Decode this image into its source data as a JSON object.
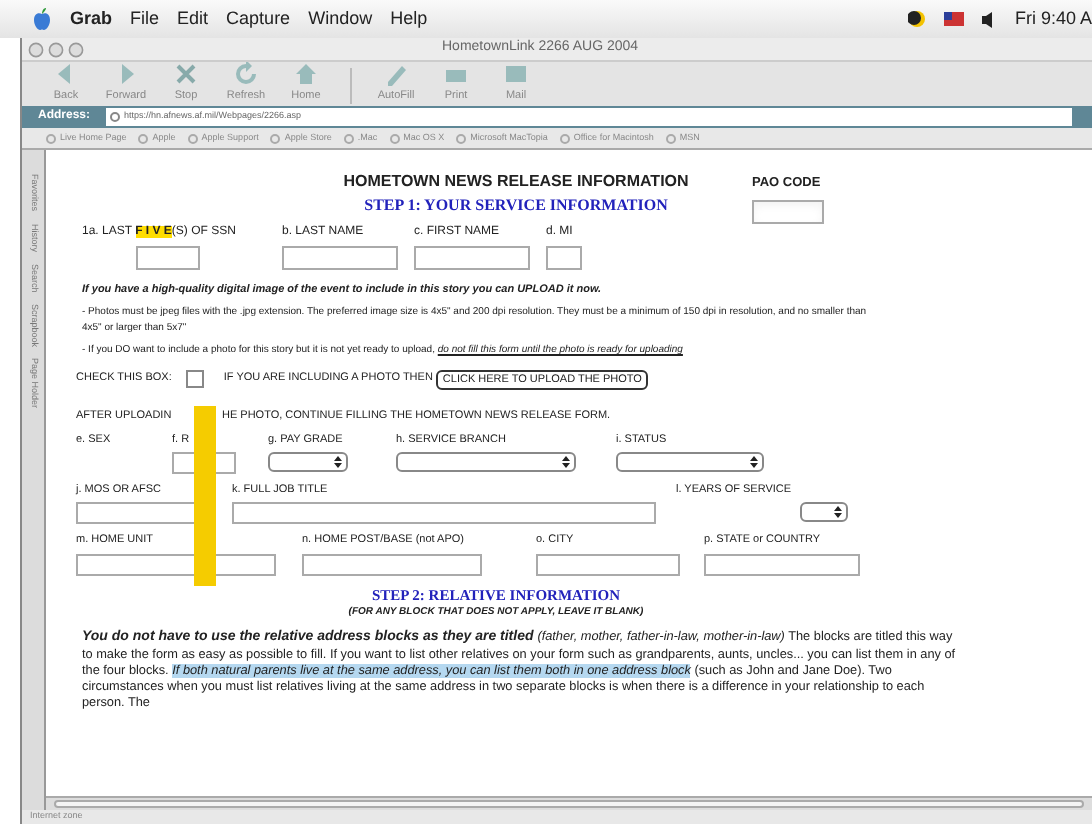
{
  "menubar": {
    "app": "Grab",
    "menus": [
      "File",
      "Edit",
      "Capture",
      "Window",
      "Help"
    ],
    "clock": "Fri 9:40 A"
  },
  "window": {
    "title": "HometownLink 2266 AUG 2004"
  },
  "toolbar": [
    {
      "kind": "button",
      "label": "Back"
    },
    {
      "kind": "button",
      "label": "Forward"
    },
    {
      "kind": "button",
      "label": "Stop"
    },
    {
      "kind": "button",
      "label": "Refresh"
    },
    {
      "kind": "button",
      "label": "Home"
    },
    {
      "kind": "separator"
    },
    {
      "kind": "button",
      "label": "AutoFill"
    },
    {
      "kind": "button",
      "label": "Print"
    },
    {
      "kind": "button",
      "label": "Mail"
    }
  ],
  "address": {
    "label": "Address:",
    "url": "https://hn.afnews.af.mil/Webpages/2266.asp"
  },
  "bookmarks": [
    "Live Home Page",
    "Apple",
    "Apple Support",
    "Apple Store",
    ".Mac",
    "Mac OS X",
    "Microsoft MacTopia",
    "Office for Macintosh",
    "MSN"
  ],
  "sidebar_tabs": [
    "Favorites",
    "History",
    "Search",
    "Scrapbook",
    "Page Holder"
  ],
  "form": {
    "heading": "HOMETOWN NEWS RELEASE INFORMATION",
    "step1": "STEP 1: YOUR SERVICE INFORMATION",
    "pao_label": "PAO CODE",
    "ssn_label": {
      "before": "1a. LAST",
      "highlight": "F I V E",
      "after": "(S) OF SSN"
    },
    "name_fields": [
      {
        "label": "b. LAST NAME"
      },
      {
        "label": "c. FIRST NAME"
      },
      {
        "label": "d. MI"
      }
    ],
    "upload_intro": "If you have a high-quality digital image of the event to include in this story you can UPLOAD it now.",
    "photo_note": "- Photos must be jpeg files with the .jpg extension. The preferred image size is 4x5\" and 200 dpi resolution. They must be a minimum of 150 dpi in resolution, and no smaller than 4x5\" or larger than 5x7\"",
    "ready_note": {
      "text": "- If you DO want to include a photo for this story but it is not yet ready to upload, ",
      "emphasis": "do not fill this form until the photo is ready for uploading"
    },
    "check_label": "CHECK THIS BOX:",
    "check": {
      "checked": false
    },
    "check_after": "IF YOU ARE INCLUDING A PHOTO THEN",
    "upload_button": "CLICK HERE TO UPLOAD THE PHOTO",
    "after_upload": [
      "AFTER UPLOADIN",
      "HE PHOTO, CONTINUE FILLING THE HOMETOWN NEWS RELEASE FORM."
    ],
    "rows": [
      [
        {
          "label": "e. SEX",
          "kind": "none"
        },
        {
          "label": "f. R",
          "kind": "text"
        },
        {
          "label": "g. PAY GRADE",
          "kind": "select"
        },
        {
          "label": "h. SERVICE BRANCH",
          "kind": "select"
        },
        {
          "label": "i. STATUS",
          "kind": "select"
        }
      ],
      [
        {
          "label": "j. MOS OR AFSC",
          "kind": "text"
        },
        {
          "label": "k. FULL JOB TITLE",
          "kind": "text"
        },
        {
          "label": "l. YEARS OF SERVICE",
          "kind": "select"
        }
      ],
      [
        {
          "label": "m. HOME UNIT",
          "kind": "text"
        },
        {
          "label": "n. HOME POST/BASE (not APO)",
          "kind": "text"
        },
        {
          "label": "o. CITY",
          "kind": "text"
        },
        {
          "label": "p. STATE or COUNTRY",
          "kind": "text"
        }
      ]
    ],
    "step2": "STEP 2: RELATIVE INFORMATION",
    "step2_note": "(FOR ANY BLOCK THAT DOES NOT APPLY, LEAVE IT BLANK)",
    "relative_text": {
      "lead": "You do not have to use the relative address blocks as they are titled",
      "aside": "(father, mother, father-in-law, mother-in-law)",
      "body": " The blocks are titled this way to make the form as easy as possible to fill. If you want to list other relatives on your form such as grandparents, aunts, uncles... you can list them in any of the four blocks. ",
      "highlight": "If both natural parents live at the same address, you can list them both in one address block",
      "tail": " (such as John and Jane Doe). Two circumstances when you must list relatives living at the same address in two separate blocks is when there is a difference in your relationship to each person. The"
    }
  },
  "status": "Internet zone"
}
